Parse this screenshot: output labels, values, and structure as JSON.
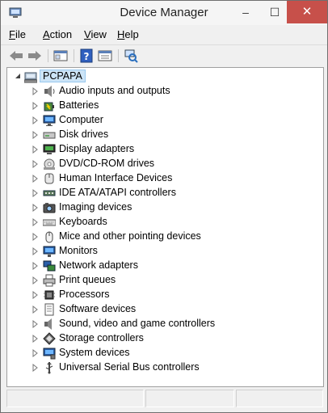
{
  "window": {
    "title": "Device Manager"
  },
  "titlebar_buttons": {
    "minimize": "–",
    "maximize": "☐",
    "close": "✕"
  },
  "menu": [
    {
      "label": "File",
      "key": "F",
      "rest": "ile"
    },
    {
      "label": "Action",
      "key": "A",
      "rest": "ction"
    },
    {
      "label": "View",
      "key": "V",
      "rest": "iew"
    },
    {
      "label": "Help",
      "key": "H",
      "rest": "elp"
    }
  ],
  "toolbar": [
    "back-icon",
    "forward-icon",
    "show-hide-console-tree-icon",
    "help-icon",
    "properties-icon",
    "scan-hardware-icon"
  ],
  "tree": {
    "root": "PCPAPA",
    "categories": [
      {
        "label": "Audio inputs and outputs",
        "icon": "audio-icon"
      },
      {
        "label": "Batteries",
        "icon": "battery-icon"
      },
      {
        "label": "Computer",
        "icon": "computer-icon"
      },
      {
        "label": "Disk drives",
        "icon": "disk-drive-icon"
      },
      {
        "label": "Display adapters",
        "icon": "display-adapter-icon"
      },
      {
        "label": "DVD/CD-ROM drives",
        "icon": "dvd-drive-icon"
      },
      {
        "label": "Human Interface Devices",
        "icon": "hid-icon"
      },
      {
        "label": "IDE ATA/ATAPI controllers",
        "icon": "ide-controller-icon"
      },
      {
        "label": "Imaging devices",
        "icon": "camera-icon"
      },
      {
        "label": "Keyboards",
        "icon": "keyboard-icon"
      },
      {
        "label": "Mice and other pointing devices",
        "icon": "mouse-icon"
      },
      {
        "label": "Monitors",
        "icon": "monitor-icon"
      },
      {
        "label": "Network adapters",
        "icon": "network-adapter-icon"
      },
      {
        "label": "Print queues",
        "icon": "printer-icon"
      },
      {
        "label": "Processors",
        "icon": "processor-icon"
      },
      {
        "label": "Software devices",
        "icon": "software-device-icon"
      },
      {
        "label": "Sound, video and game controllers",
        "icon": "speaker-icon"
      },
      {
        "label": "Storage controllers",
        "icon": "storage-controller-icon"
      },
      {
        "label": "System devices",
        "icon": "system-device-icon"
      },
      {
        "label": "Universal Serial Bus controllers",
        "icon": "usb-icon"
      }
    ]
  }
}
